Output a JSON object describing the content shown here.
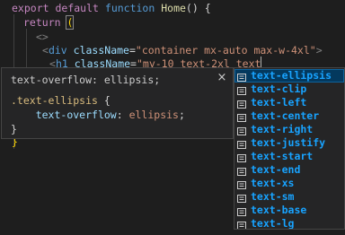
{
  "code": {
    "line1": {
      "kw1": "export",
      "kw2": "default",
      "kw3": "function",
      "fn": "Home",
      "rest": "() {"
    },
    "line2": {
      "kw": "return",
      "paren": "("
    },
    "line3": {
      "frag": "<>"
    },
    "line4": {
      "open": "<",
      "tag": "div",
      "attr": "className",
      "eq": "=",
      "str": "\"container mx-auto max-w-4xl\"",
      "close": ">"
    },
    "line5": {
      "open": "<",
      "tag": "h1",
      "attr": "className",
      "eq": "=",
      "str": "\"my-10 text-2xl text"
    },
    "line6": {
      "brace": "}"
    }
  },
  "doc": {
    "header": "text-overflow: ellipsis;",
    "close_glyph": "×",
    "selector": ".text-ellipsis",
    "open_brace": " {",
    "property": "text-overflow",
    "colon": ": ",
    "value": "ellipsis",
    "semi": ";",
    "close_brace": "}"
  },
  "suggestions": [
    "text-ellipsis",
    "text-clip",
    "text-left",
    "text-center",
    "text-right",
    "text-justify",
    "text-start",
    "text-end",
    "text-xs",
    "text-sm",
    "text-base",
    "text-lg"
  ],
  "colors": {
    "background": "#1e1e1e",
    "active_item": "#04395e",
    "suggestion_text": "#18a3ff"
  },
  "icons": {
    "suggestion_icon": "constant-icon"
  }
}
